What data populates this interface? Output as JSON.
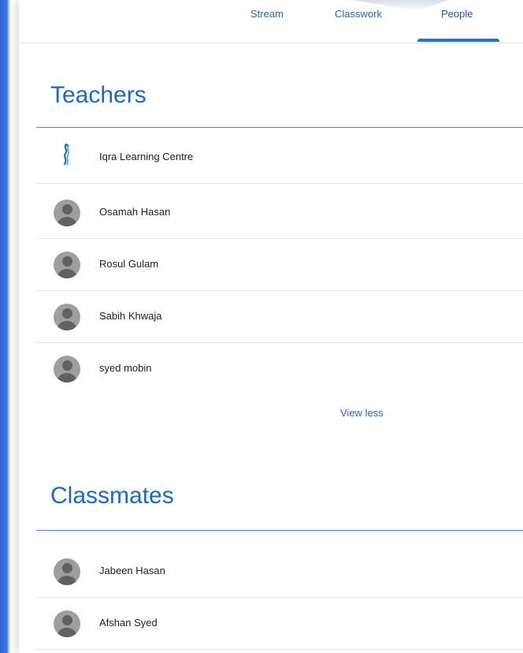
{
  "tabs": [
    {
      "label": "Stream"
    },
    {
      "label": "Classwork"
    },
    {
      "label": "People",
      "active": true
    }
  ],
  "teachers": {
    "title": "Teachers",
    "people": [
      {
        "name": "Iqra Learning Centre",
        "avatar": "logo-icon"
      },
      {
        "name": "Osamah Hasan",
        "avatar": "person-icon"
      },
      {
        "name": "Rosul Gulam",
        "avatar": "person-icon"
      },
      {
        "name": "Sabih Khwaja",
        "avatar": "person-icon"
      },
      {
        "name": "syed mobin",
        "avatar": "person-icon"
      }
    ],
    "toggle_label": "View less"
  },
  "classmates": {
    "title": "Classmates",
    "people": [
      {
        "name": "Jabeen Hasan",
        "avatar": "person-icon"
      },
      {
        "name": "Afshan Syed",
        "avatar": "person-icon"
      }
    ]
  },
  "colors": {
    "accent": "#1967d2",
    "left_bar": "#2a62d1",
    "avatar_bg": "#9e9e9e",
    "avatar_fg": "#616161"
  }
}
